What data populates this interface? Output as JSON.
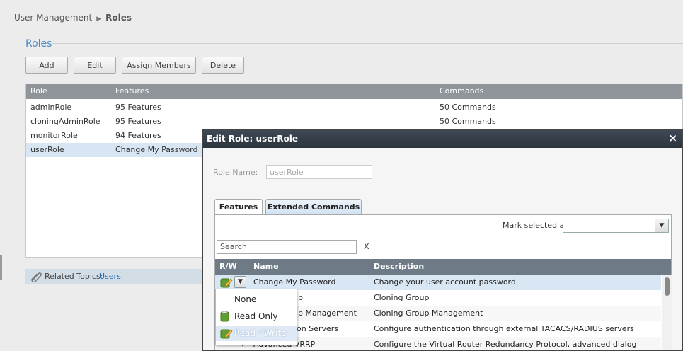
{
  "breadcrumb": {
    "parent": "User Management",
    "current": "Roles"
  },
  "section": {
    "title": "Roles"
  },
  "toolbar": {
    "add": "Add",
    "edit": "Edit",
    "assign": "Assign Members",
    "delete": "Delete"
  },
  "roles_table": {
    "headers": {
      "role": "Role",
      "features": "Features",
      "commands": "Commands"
    },
    "rows": [
      {
        "role": "adminRole",
        "features": "95 Features",
        "commands": "50 Commands"
      },
      {
        "role": "cloningAdminRole",
        "features": "95 Features",
        "commands": "50 Commands"
      },
      {
        "role": "monitorRole",
        "features": "94 Features",
        "commands": ""
      },
      {
        "role": "userRole",
        "features": "Change My Password",
        "commands": ""
      }
    ]
  },
  "related": {
    "label": "Related Topics:",
    "link": "Users"
  },
  "dialog": {
    "title": "Edit Role: userRole",
    "close": "×",
    "role_name_label": "Role Name:",
    "role_name_value": "userRole",
    "tabs": {
      "features": "Features",
      "extended": "Extended Commands"
    },
    "mark_label": "Mark selected as:",
    "search_value": "Search",
    "search_clear": "X",
    "grid": {
      "headers": {
        "rw": "R/W",
        "name": "Name",
        "description": "Description"
      },
      "rows": [
        {
          "name": "Change My Password",
          "description": "Change your user account password"
        },
        {
          "name": "up",
          "description": "Cloning Group"
        },
        {
          "name": "up Management",
          "description": "Cloning Group Management"
        },
        {
          "name": "on Servers",
          "description": "Configure authentication through external TACACS/RADIUS servers"
        },
        {
          "name": "Advanced VRRP",
          "description": "Configure the Virtual Router Redundancy Protocol, advanced dialog"
        }
      ]
    }
  },
  "popup": {
    "options": [
      "None",
      "Read Only",
      "Read / Write"
    ]
  },
  "colors": {
    "accent": "#4a8ac4",
    "header": "#6e7b86",
    "selection": "#d9e6f4"
  }
}
